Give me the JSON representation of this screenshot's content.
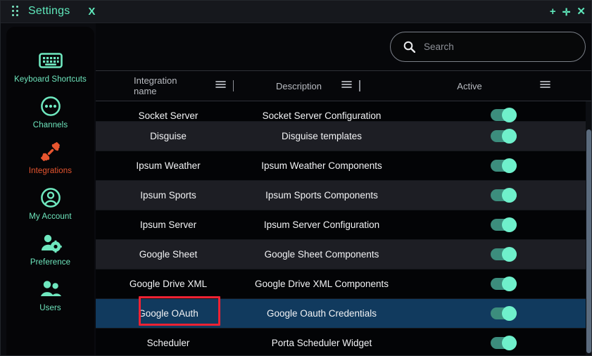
{
  "window": {
    "title": "Settings",
    "close_label": "X",
    "drag_handle": "drag-dots",
    "controls": {
      "add": "+",
      "move": "✛",
      "close": "✕"
    }
  },
  "sidebar": {
    "items": [
      {
        "label": "Keyboard Shortcuts",
        "icon": "keyboard-icon",
        "active": false
      },
      {
        "label": "Channels",
        "icon": "channels-icon",
        "active": false
      },
      {
        "label": "Integrations",
        "icon": "integrations-plug-icon",
        "active": true
      },
      {
        "label": "My Account",
        "icon": "user-circle-icon",
        "active": false
      },
      {
        "label": "Preference",
        "icon": "preference-gear-icon",
        "active": false
      },
      {
        "label": "Users",
        "icon": "users-icon",
        "active": false
      }
    ]
  },
  "search": {
    "placeholder": "Search",
    "value": "",
    "icon": "search-icon"
  },
  "table": {
    "columns": [
      {
        "label": "Integration name",
        "menu_icon": "hamburger-icon"
      },
      {
        "label": "Description",
        "menu_icon": "hamburger-icon"
      },
      {
        "label": "Active",
        "menu_icon": "hamburger-icon"
      }
    ],
    "rows": [
      {
        "name": "Socket Server",
        "description": "Socket Server Configuration",
        "active": true,
        "selected": false,
        "clipped": true
      },
      {
        "name": "Disguise",
        "description": "Disguise templates",
        "active": true,
        "selected": false
      },
      {
        "name": "Ipsum Weather",
        "description": "Ipsum Weather Components",
        "active": true,
        "selected": false
      },
      {
        "name": "Ipsum Sports",
        "description": "Ipsum Sports Components",
        "active": true,
        "selected": false
      },
      {
        "name": "Ipsum Server",
        "description": "Ipsum Server Configuration",
        "active": true,
        "selected": false
      },
      {
        "name": "Google Sheet",
        "description": "Google Sheet Components",
        "active": true,
        "selected": false
      },
      {
        "name": "Google Drive XML",
        "description": "Google Drive XML Components",
        "active": true,
        "selected": false
      },
      {
        "name": "Google OAuth",
        "description": "Google Oauth Credentials",
        "active": true,
        "selected": true
      },
      {
        "name": "Scheduler",
        "description": "Porta Scheduler Widget",
        "active": true,
        "selected": false
      }
    ]
  },
  "annotation": {
    "target": "Google OAuth",
    "color": "#ee2233"
  },
  "colors": {
    "accent_teal": "#5fe8bb",
    "accent_orange": "#e8552f",
    "row_dark": "#030406",
    "row_light": "#1d1e24",
    "row_selected": "#113a5e",
    "toggle_track": "#3c8d7d",
    "toggle_knob": "#6ff0cb"
  }
}
